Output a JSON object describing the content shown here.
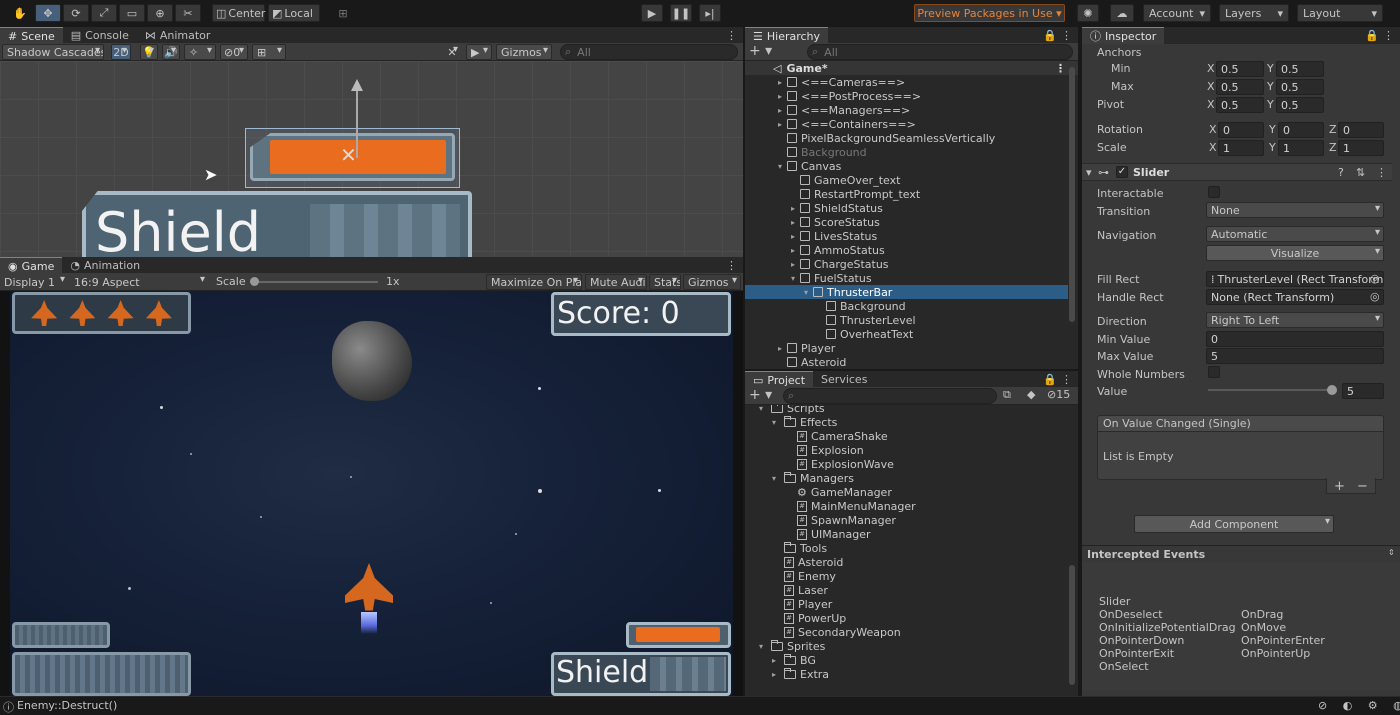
{
  "toolbar": {
    "center_label": "Center",
    "local_label": "Local",
    "preview_packages": "Preview Packages in Use",
    "account": "Account",
    "layers": "Layers",
    "layout": "Layout"
  },
  "scene": {
    "tabs": [
      "Scene",
      "Console",
      "Animator"
    ],
    "shading": "Shadow Cascades",
    "mode_2d": "2D",
    "hidden_count": "0",
    "gizmos": "Gizmos",
    "search_placeholder": "All",
    "shield_text": "Shield"
  },
  "game": {
    "tabs": [
      "Game",
      "Animation"
    ],
    "display": "Display 1",
    "aspect": "16:9 Aspect",
    "scale_label": "Scale",
    "scale_value": "1x",
    "maximize": "Maximize On Play",
    "mute": "Mute Audio",
    "stats": "Stats",
    "gizmos": "Gizmos",
    "score": "Score: 0",
    "shield": "Shield",
    "lives": 4
  },
  "hierarchy": {
    "title": "Hierarchy",
    "search_placeholder": "All",
    "scene_name": "Game*",
    "items": [
      {
        "label": "<==Cameras==>",
        "depth": 1,
        "arrow": "▸"
      },
      {
        "label": "<==PostProcess==>",
        "depth": 1,
        "arrow": "▸"
      },
      {
        "label": "<==Managers==>",
        "depth": 1,
        "arrow": "▸"
      },
      {
        "label": "<==Containers==>",
        "depth": 1,
        "arrow": "▸"
      },
      {
        "label": "PixelBackgroundSeamlessVertically",
        "depth": 1,
        "arrow": ""
      },
      {
        "label": "Background",
        "depth": 1,
        "arrow": "",
        "dim": true
      },
      {
        "label": "Canvas",
        "depth": 1,
        "arrow": "▾"
      },
      {
        "label": "GameOver_text",
        "depth": 2,
        "arrow": ""
      },
      {
        "label": "RestartPrompt_text",
        "depth": 2,
        "arrow": ""
      },
      {
        "label": "ShieldStatus",
        "depth": 2,
        "arrow": "▸"
      },
      {
        "label": "ScoreStatus",
        "depth": 2,
        "arrow": "▸"
      },
      {
        "label": "LivesStatus",
        "depth": 2,
        "arrow": "▸"
      },
      {
        "label": "AmmoStatus",
        "depth": 2,
        "arrow": "▸"
      },
      {
        "label": "ChargeStatus",
        "depth": 2,
        "arrow": "▸"
      },
      {
        "label": "FuelStatus",
        "depth": 2,
        "arrow": "▾"
      },
      {
        "label": "ThrusterBar",
        "depth": 3,
        "arrow": "▾",
        "selected": true
      },
      {
        "label": "Background",
        "depth": 4,
        "arrow": ""
      },
      {
        "label": "ThrusterLevel",
        "depth": 4,
        "arrow": ""
      },
      {
        "label": "OverheatText",
        "depth": 4,
        "arrow": ""
      },
      {
        "label": "Player",
        "depth": 1,
        "arrow": "▸"
      },
      {
        "label": "Asteroid",
        "depth": 1,
        "arrow": ""
      }
    ]
  },
  "project": {
    "tabs": [
      "Project",
      "Services"
    ],
    "hidden_count": "15",
    "items": [
      {
        "label": "Scripts",
        "depth": 0,
        "type": "folder",
        "arrow": "▾"
      },
      {
        "label": "Effects",
        "depth": 1,
        "type": "folder",
        "arrow": "▾"
      },
      {
        "label": "CameraShake",
        "depth": 2,
        "type": "script"
      },
      {
        "label": "Explosion",
        "depth": 2,
        "type": "script"
      },
      {
        "label": "ExplosionWave",
        "depth": 2,
        "type": "script"
      },
      {
        "label": "Managers",
        "depth": 1,
        "type": "folder",
        "arrow": "▾"
      },
      {
        "label": "GameManager",
        "depth": 2,
        "type": "gear"
      },
      {
        "label": "MainMenuManager",
        "depth": 2,
        "type": "script"
      },
      {
        "label": "SpawnManager",
        "depth": 2,
        "type": "script"
      },
      {
        "label": "UIManager",
        "depth": 2,
        "type": "script"
      },
      {
        "label": "Tools",
        "depth": 1,
        "type": "folder"
      },
      {
        "label": "Asteroid",
        "depth": 1,
        "type": "script"
      },
      {
        "label": "Enemy",
        "depth": 1,
        "type": "script"
      },
      {
        "label": "Laser",
        "depth": 1,
        "type": "script"
      },
      {
        "label": "Player",
        "depth": 1,
        "type": "script"
      },
      {
        "label": "PowerUp",
        "depth": 1,
        "type": "script"
      },
      {
        "label": "SecondaryWeapon",
        "depth": 1,
        "type": "script"
      },
      {
        "label": "Sprites",
        "depth": 0,
        "type": "folder",
        "arrow": "▾"
      },
      {
        "label": "BG",
        "depth": 1,
        "type": "folder",
        "arrow": "▸"
      },
      {
        "label": "Extra",
        "depth": 1,
        "type": "folder",
        "arrow": "▸"
      }
    ]
  },
  "inspector": {
    "title": "Inspector",
    "anchors": "Anchors",
    "min": "Min",
    "max": "Max",
    "pivot": "Pivot",
    "rotation": "Rotation",
    "scale": "Scale",
    "ax": "X",
    "ay": "Y",
    "az": "Z",
    "min_x": "0.5",
    "min_y": "0.5",
    "max_x": "0.5",
    "max_y": "0.5",
    "pivot_x": "0.5",
    "pivot_y": "0.5",
    "rot_x": "0",
    "rot_y": "0",
    "rot_z": "0",
    "scale_x": "1",
    "scale_y": "1",
    "scale_z": "1",
    "component": "Slider",
    "interactable": "Interactable",
    "transition": "Transition",
    "transition_value": "None",
    "navigation": "Navigation",
    "navigation_value": "Automatic",
    "visualize": "Visualize",
    "fill_rect": "Fill Rect",
    "fill_rect_value": "ThrusterLevel (Rect Transform)",
    "handle_rect": "Handle Rect",
    "handle_rect_value": "None (Rect Transform)",
    "direction": "Direction",
    "direction_value": "Right To Left",
    "min_value": "Min Value",
    "min_value_value": "0",
    "max_value": "Max Value",
    "max_value_value": "5",
    "whole_numbers": "Whole Numbers",
    "value": "Value",
    "value_value": "5",
    "value_fraction": 1.0,
    "event_title": "On Value Changed (Single)",
    "list_empty": "List is Empty",
    "add_component": "Add Component",
    "intercepted": "Intercepted Events",
    "events_header": "Slider",
    "events_col1": [
      "OnDeselect",
      "OnInitializePotentialDrag",
      "OnPointerDown",
      "OnPointerExit",
      "OnSelect"
    ],
    "events_col2": [
      "OnDrag",
      "OnMove",
      "OnPointerEnter",
      "OnPointerUp"
    ]
  },
  "status": {
    "message": "Enemy::Destruct()"
  }
}
